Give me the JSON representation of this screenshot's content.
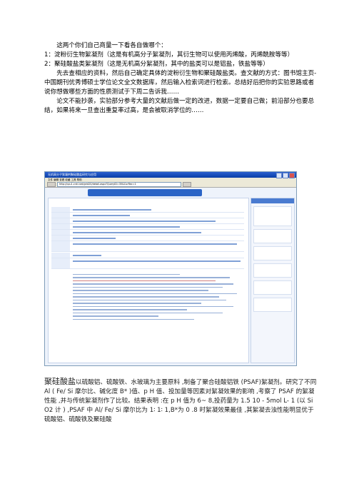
{
  "intro": {
    "p1": "这两个你们自己商量一下看各自做哪个：",
    "p2": "1：淀粉衍生物絮凝剂（这是有机高分子絮凝剂，其衍生物可以使用丙烯酸，丙烯酰胺等等）",
    "p3": "2：聚硅酸盐类絮凝剂（这是无机高分絮凝剂，其中的盐类可以是铝盐，铁盐等等）",
    "p4": "先去查相应的资料，然后自己确定具体的淀粉衍生物和聚硅酸盐类。查文献的方式：图书馆主页-中国期刊优秀博硕士学位论文全文数据库，然后输入检索词进行检索。总结好后把你的实验思路或者说你想做哪些方面的性质测试于下周二告诉我……",
    "p5": "论文不能抄袭，实验部分参考大量的文献后做一定的改进，数据一定要自己做；前沿部分也要总结，如果将来一旦查出重复率过高，是会被取消学位的……"
  },
  "screenshot": {
    "window_title": "无机高分子絮凝剂聚硅酸盐研究与应用",
    "menu": "文件  编辑  查看  收藏  工具  帮助",
    "address": "http://cpu1.cnki.net/grid20/detail.aspx?QueryID=35&CurRec=1"
  },
  "abstract": {
    "lead": "聚硅酸盐",
    "body": "以硫酸铝、硫酸铁、水玻璃为主要原料 ,制备了聚合硅酸铝铁 (PSAF)絮凝剂。研究了不同 Al ( Fe/ Si 摩尔比、碱化度 B* )值、p H 值、投加量等因素对絮凝效果的影响 ,考察了 PSAF 的絮凝性能 ,并与传统絮凝剂作了比较。结果表明 :在 p H 值为 6~ 8,投药量为 1.5 10 - 5mol L- 1 (以 Si O2 计 ) ,PSAF 中 Al/ Fe/ Si 摩尔比为 1∶ 1∶ 1,B*为 0 .8 时絮凝效果最佳 ,其絮凝去浊性能明显优于硫酸铝、硫酸铁及聚硅酸"
  }
}
